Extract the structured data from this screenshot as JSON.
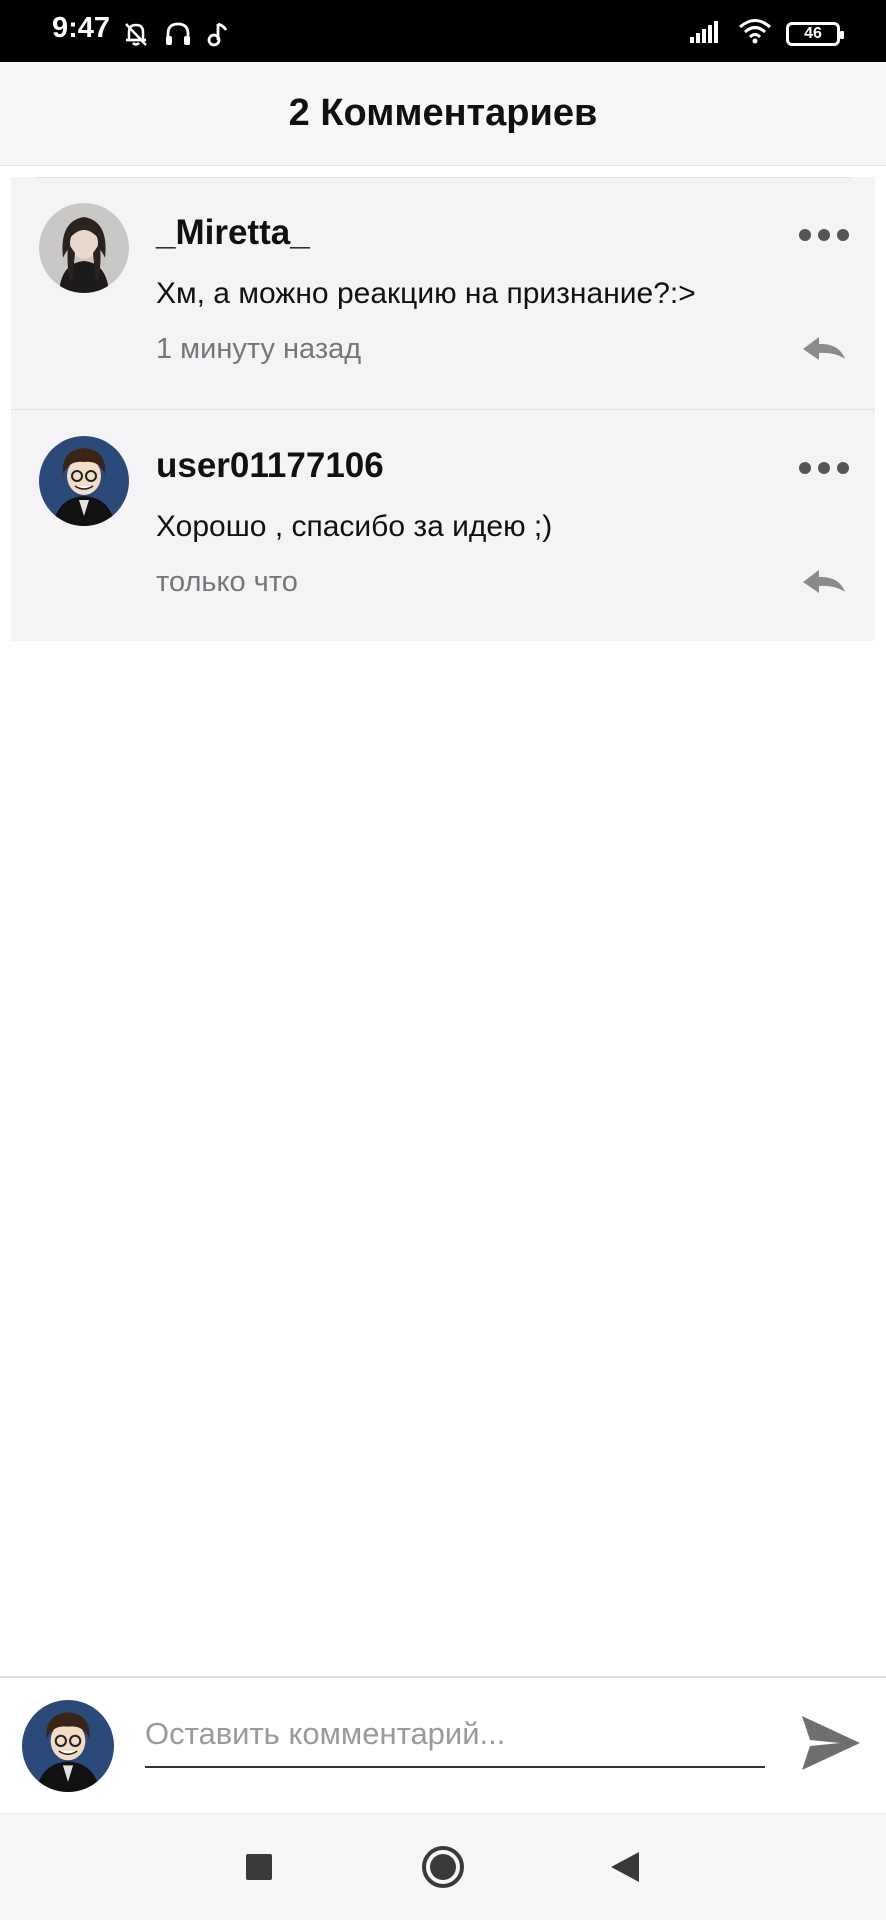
{
  "status_bar": {
    "time": "9:47",
    "left_icons": [
      "muted-bell-icon",
      "headphones-icon",
      "music-note-icon"
    ],
    "right_icons": [
      "signal-icon",
      "wifi-icon",
      "battery-icon"
    ],
    "battery_level": "46"
  },
  "header": {
    "title": "2 Комментариев"
  },
  "comments": [
    {
      "username": "_Miretta_",
      "text": "Хм, а можно реакцию на признание?:>",
      "time": "1 минуту назад",
      "avatar": "avatar-miretta"
    },
    {
      "username": "user01177106",
      "text": "Хорошо , спасибо за идею ;)",
      "time": "только что",
      "avatar": "avatar-user01177106"
    }
  ],
  "input_bar": {
    "placeholder": "Оставить комментарий...",
    "value": ""
  },
  "nav_bar": {
    "buttons": [
      "recents-square-icon",
      "home-circle-icon",
      "back-triangle-icon"
    ]
  },
  "colors": {
    "status_bar_bg": "#000000",
    "header_bg": "#f7f6f8",
    "comment_bg": "#f4f3f6",
    "secondary_text": "#77777a",
    "icon_gray": "#555555"
  }
}
